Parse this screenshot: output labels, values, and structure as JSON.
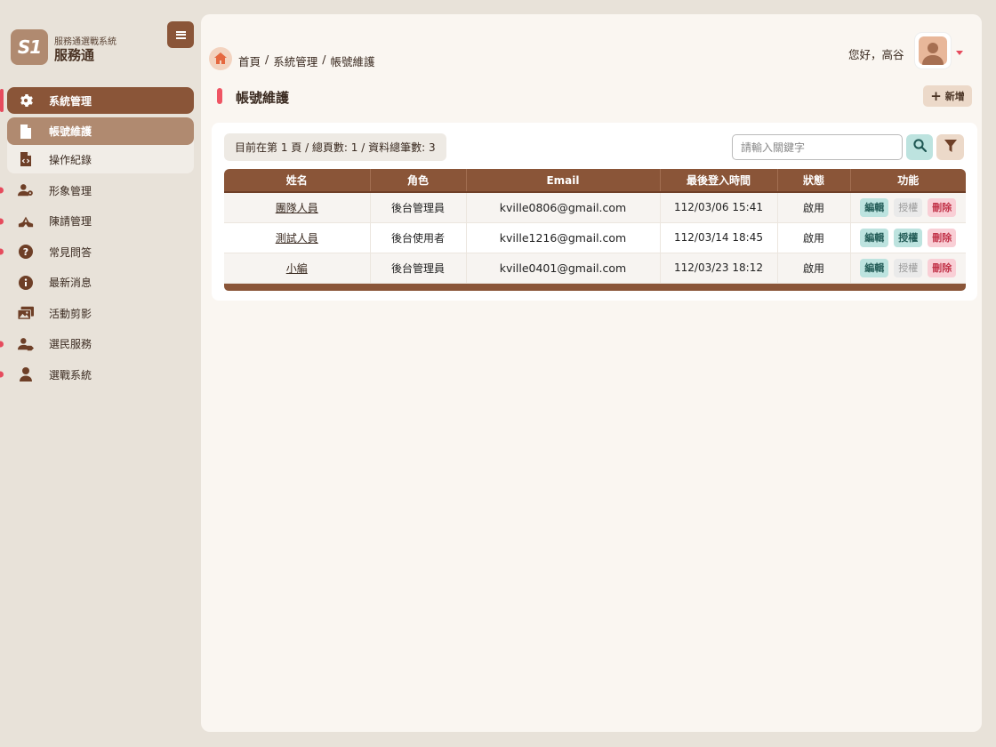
{
  "brand": {
    "logo_text": "S1",
    "subtitle": "服務通選戰系統",
    "name": "服務通"
  },
  "sidebar": {
    "items": [
      {
        "label": "系統管理",
        "icon": "gear-icon",
        "active": true
      },
      {
        "label": "形象管理",
        "icon": "user-gear-icon"
      },
      {
        "label": "陳請管理",
        "icon": "hands-icon"
      },
      {
        "label": "常見問答",
        "icon": "question-icon"
      },
      {
        "label": "最新消息",
        "icon": "info-icon"
      },
      {
        "label": "活動剪影",
        "icon": "images-icon"
      },
      {
        "label": "選民服務",
        "icon": "user-tag-icon"
      },
      {
        "label": "選戰系統",
        "icon": "user-icon"
      }
    ],
    "submenu": [
      {
        "label": "帳號維護",
        "icon": "file-icon",
        "selected": true
      },
      {
        "label": "操作紀錄",
        "icon": "file-code-icon"
      }
    ]
  },
  "header": {
    "breadcrumb": [
      "首頁",
      "系統管理",
      "帳號維護"
    ],
    "greeting": "您好，高谷"
  },
  "page": {
    "title": "帳號維護",
    "add_label": "新增"
  },
  "toolbar": {
    "pager_info": "目前在第 1 頁 / 總頁數: 1 / 資料總筆數: 3",
    "search_placeholder": "請輸入關鍵字"
  },
  "table": {
    "columns": [
      "姓名",
      "角色",
      "Email",
      "最後登入時間",
      "狀態",
      "功能"
    ],
    "rows": [
      {
        "name": "團隊人員",
        "role": "後台管理員",
        "email": "kville0806@gmail.com",
        "last_login": "112/03/06 15:41",
        "status": "啟用"
      },
      {
        "name": "測試人員",
        "role": "後台使用者",
        "email": "kville1216@gmail.com",
        "last_login": "112/03/14 18:45",
        "status": "啟用"
      },
      {
        "name": "小編",
        "role": "後台管理員",
        "email": "kville0401@gmail.com",
        "last_login": "112/03/23 18:12",
        "status": "啟用"
      }
    ],
    "actions": {
      "edit": "編輯",
      "authorize": "授權",
      "delete": "刪除"
    }
  },
  "colors": {
    "brand": "#8a5538",
    "accent": "#e64b5d",
    "edit": "#bde3df",
    "delete": "#f9cfd6"
  }
}
